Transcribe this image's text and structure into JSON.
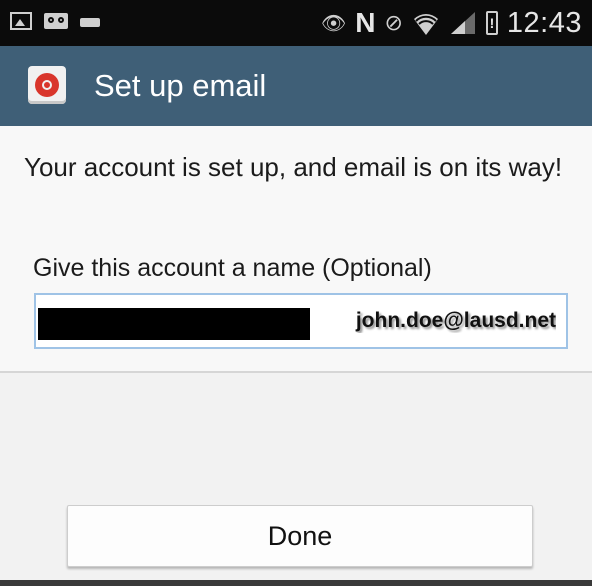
{
  "status_bar": {
    "time": "12:43",
    "network_letter": "N",
    "battery_alert": "!",
    "icons": [
      "gallery-icon",
      "voicemail-icon",
      "keyboard-icon",
      "eye-icon",
      "nfc-icon",
      "no-sim-icon",
      "wifi-icon",
      "signal-icon",
      "battery-icon"
    ]
  },
  "action_bar": {
    "title": "Set up email",
    "icon": "email-app-icon",
    "color": "#3f5f77"
  },
  "content": {
    "message": "Your account is set up, and email is on its way!",
    "name_field": {
      "label": "Give this account a name (Optional)",
      "value": "john.doe@lausd.net"
    }
  },
  "actions": {
    "done_label": "Done"
  }
}
